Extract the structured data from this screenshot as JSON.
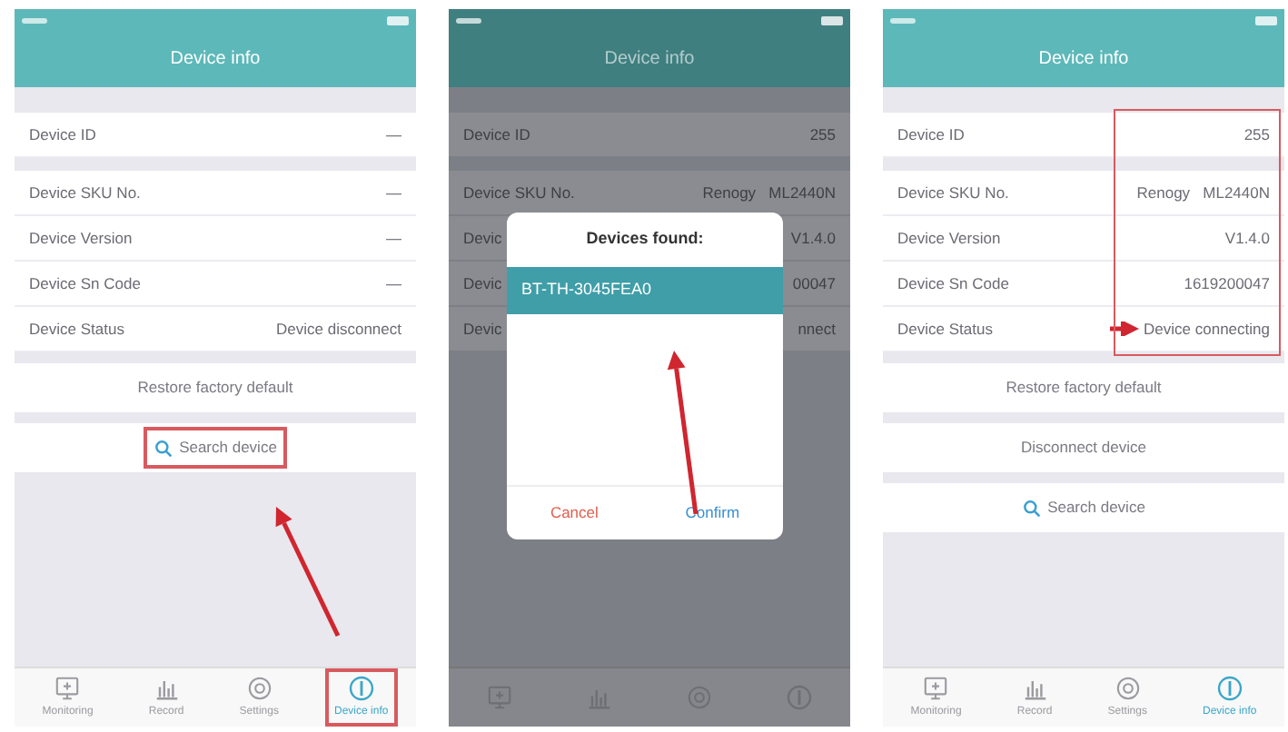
{
  "screens": [
    {
      "title": "Device info",
      "dimmed": false,
      "values_highlighted": false,
      "rows": [
        {
          "label": "Device ID",
          "value": "—"
        },
        {
          "label": "Device SKU No.",
          "value": "—"
        },
        {
          "label": "Device Version",
          "value": "—"
        },
        {
          "label": "Device Sn Code",
          "value": "—"
        },
        {
          "label": "Device Status",
          "value": "Device disconnect"
        }
      ],
      "actions": [
        {
          "label": "Restore factory default",
          "kind": "plain",
          "highlighted": false
        },
        {
          "label": "Search device",
          "kind": "search",
          "highlighted": true
        }
      ],
      "tabs": [
        {
          "label": "Monitoring",
          "selected": false,
          "highlighted": false
        },
        {
          "label": "Record",
          "selected": false,
          "highlighted": false
        },
        {
          "label": "Settings",
          "selected": false,
          "highlighted": false
        },
        {
          "label": "Device info",
          "selected": true,
          "highlighted": true
        }
      ]
    },
    {
      "title": "Device info",
      "dimmed": true,
      "values_highlighted": false,
      "rows": [
        {
          "label": "Device ID",
          "value": "255"
        },
        {
          "label": "Device SKU No.",
          "value": "Renogy   ML2440N"
        },
        {
          "label": "Devic",
          "value": "V1.4.0"
        },
        {
          "label": "Devic",
          "value": "00047"
        },
        {
          "label": "Devic",
          "value": "nnect"
        }
      ],
      "dialog": {
        "title": "Devices found:",
        "items": [
          {
            "label": "BT-TH-3045FEA0",
            "selected": true
          }
        ],
        "cancel": "Cancel",
        "confirm": "Confirm"
      }
    },
    {
      "title": "Device info",
      "dimmed": false,
      "values_highlighted": true,
      "rows": [
        {
          "label": "Device ID",
          "value": "255"
        },
        {
          "label": "Device SKU No.",
          "value": "Renogy   ML2440N"
        },
        {
          "label": "Device Version",
          "value": "V1.4.0"
        },
        {
          "label": "Device Sn Code",
          "value": "1619200047"
        },
        {
          "label": "Device Status",
          "value": "Device connecting"
        }
      ],
      "actions": [
        {
          "label": "Restore factory default",
          "kind": "plain",
          "highlighted": false
        },
        {
          "label": "Disconnect device",
          "kind": "plain",
          "highlighted": false
        },
        {
          "label": "Search device",
          "kind": "search",
          "highlighted": false
        }
      ],
      "tabs": [
        {
          "label": "Monitoring",
          "selected": false,
          "highlighted": false
        },
        {
          "label": "Record",
          "selected": false,
          "highlighted": false
        },
        {
          "label": "Settings",
          "selected": false,
          "highlighted": false
        },
        {
          "label": "Device info",
          "selected": true,
          "highlighted": false
        }
      ]
    }
  ]
}
